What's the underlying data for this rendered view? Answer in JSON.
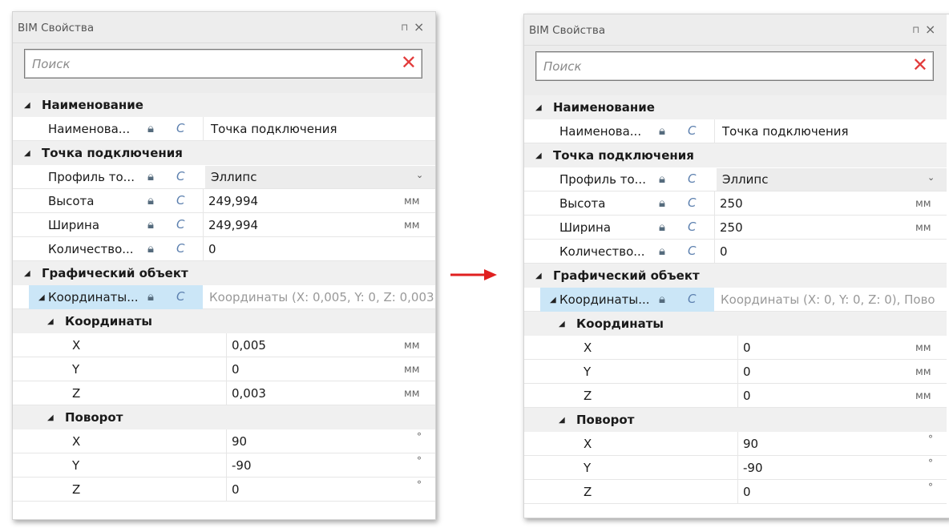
{
  "panel_title": "BIM Свойства",
  "title_icons": {
    "pin": "pin-icon",
    "close": "close-icon"
  },
  "search": {
    "placeholder": "Поиск",
    "clear_icon": "clear-icon"
  },
  "colors": {
    "clear_icon": "#e23b3b",
    "arrow": "#e02020",
    "selected_row": "#cbe6f7"
  },
  "transition_arrow": "arrow-right-icon",
  "before": {
    "groups": {
      "naming": "Наименование",
      "connection_point": "Точка подключения",
      "graphic_object": "Графический объект",
      "coords_sub": "Координаты",
      "rotation_sub": "Поворот"
    },
    "rows": {
      "name_label": "Наименова...",
      "name_value": "Точка подключения",
      "profile_label": "Профиль то...",
      "profile_value": "Эллипс",
      "height_label": "Высота",
      "height_value": "249,994",
      "height_unit": "мм",
      "width_label": "Ширина",
      "width_value": "249,994",
      "width_unit": "мм",
      "count_label": "Количество...",
      "count_value": "0",
      "coords_label": "Координаты...",
      "coords_value": "Координаты (X: 0,005, Y: 0, Z: 0,003",
      "cx_label": "X",
      "cx_value": "0,005",
      "cx_unit": "мм",
      "cy_label": "Y",
      "cy_value": "0",
      "cy_unit": "мм",
      "cz_label": "Z",
      "cz_value": "0,003",
      "cz_unit": "мм",
      "rx_label": "X",
      "rx_value": "90",
      "rx_unit": "°",
      "ry_label": "Y",
      "ry_value": "-90",
      "ry_unit": "°",
      "rz_label": "Z",
      "rz_value": "0",
      "rz_unit": "°"
    }
  },
  "after": {
    "groups": {
      "naming": "Наименование",
      "connection_point": "Точка подключения",
      "graphic_object": "Графический объект",
      "coords_sub": "Координаты",
      "rotation_sub": "Поворот"
    },
    "rows": {
      "name_label": "Наименова...",
      "name_value": "Точка подключения",
      "profile_label": "Профиль то...",
      "profile_value": "Эллипс",
      "height_label": "Высота",
      "height_value": "250",
      "height_unit": "мм",
      "width_label": "Ширина",
      "width_value": "250",
      "width_unit": "мм",
      "count_label": "Количество...",
      "count_value": "0",
      "coords_label": "Координаты...",
      "coords_value": "Координаты (X: 0, Y: 0, Z: 0), Пово",
      "cx_label": "X",
      "cx_value": "0",
      "cx_unit": "мм",
      "cy_label": "Y",
      "cy_value": "0",
      "cy_unit": "мм",
      "cz_label": "Z",
      "cz_value": "0",
      "cz_unit": "мм",
      "rx_label": "X",
      "rx_value": "90",
      "rx_unit": "°",
      "ry_label": "Y",
      "ry_value": "-90",
      "ry_unit": "°",
      "rz_label": "Z",
      "rz_value": "0",
      "rz_unit": "°"
    }
  }
}
